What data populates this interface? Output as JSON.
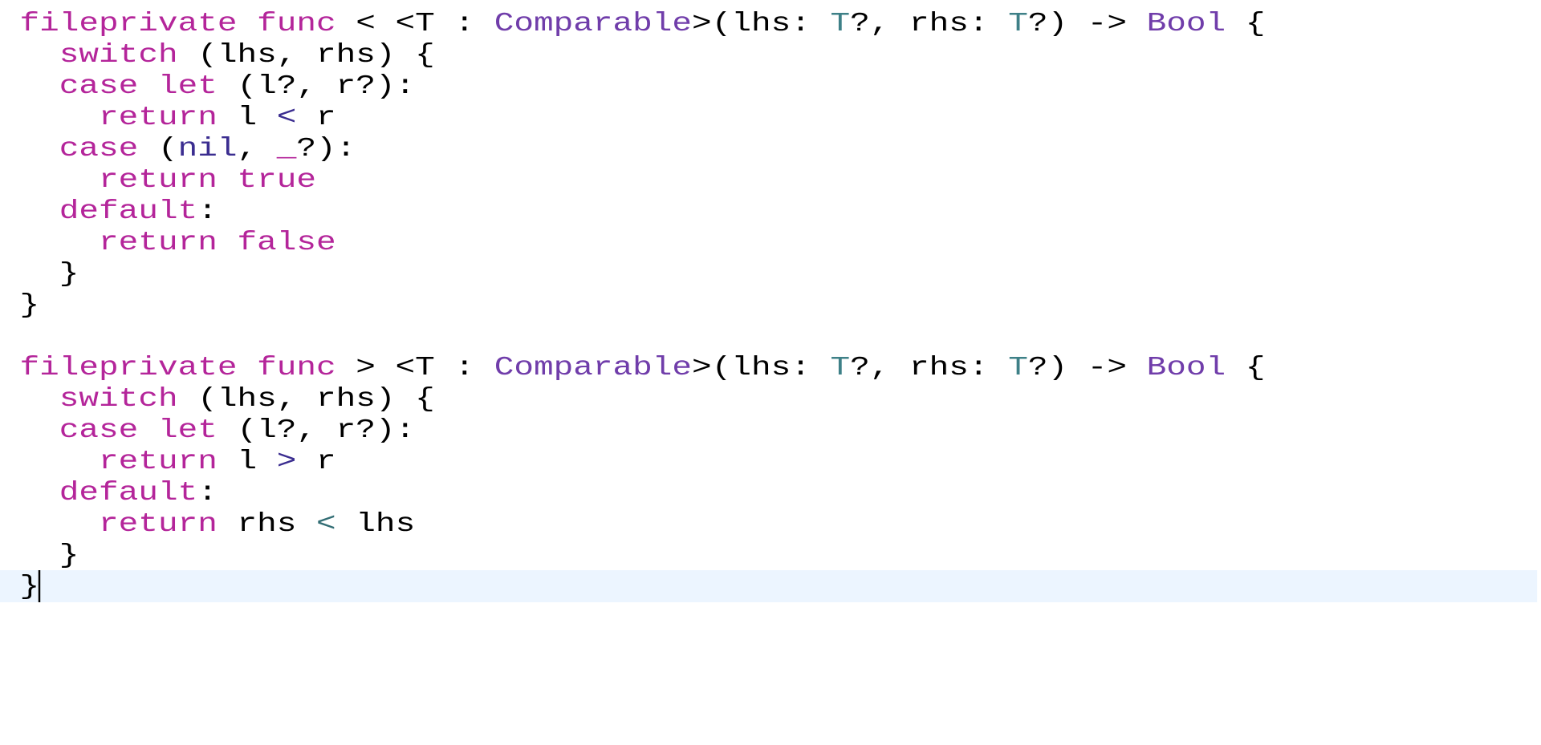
{
  "editor": {
    "colors": {
      "keyword": "#b4259a",
      "type": "#703daa",
      "type_param": "#3e8087",
      "literal": "#b4259a",
      "nil": "#3b2d90",
      "operator": "#3b2d90",
      "operator_alt": "#326d74",
      "plain": "#000000",
      "current_line_bg": "#ecf5ff"
    },
    "current_line": 19,
    "lines": [
      {
        "tokens": [
          {
            "t": "fileprivate",
            "c": "kw"
          },
          {
            "t": " "
          },
          {
            "t": "func",
            "c": "kw"
          },
          {
            "t": " < <T : "
          },
          {
            "t": "Comparable",
            "c": "type"
          },
          {
            "t": ">(lhs: "
          },
          {
            "t": "T",
            "c": "tp"
          },
          {
            "t": "?, rhs: "
          },
          {
            "t": "T",
            "c": "tp"
          },
          {
            "t": "?) -> "
          },
          {
            "t": "Bool",
            "c": "type"
          },
          {
            "t": " {"
          }
        ]
      },
      {
        "tokens": [
          {
            "t": "  "
          },
          {
            "t": "switch",
            "c": "kw"
          },
          {
            "t": " (lhs, rhs) {"
          }
        ]
      },
      {
        "tokens": [
          {
            "t": "  "
          },
          {
            "t": "case",
            "c": "kw"
          },
          {
            "t": " "
          },
          {
            "t": "let",
            "c": "kw"
          },
          {
            "t": " (l?, r?):"
          }
        ]
      },
      {
        "tokens": [
          {
            "t": "    "
          },
          {
            "t": "return",
            "c": "kw"
          },
          {
            "t": " l "
          },
          {
            "t": "<",
            "c": "op"
          },
          {
            "t": " r"
          }
        ]
      },
      {
        "tokens": [
          {
            "t": "  "
          },
          {
            "t": "case",
            "c": "kw"
          },
          {
            "t": " ("
          },
          {
            "t": "nil",
            "c": "nil"
          },
          {
            "t": ", "
          },
          {
            "t": "_",
            "c": "kw"
          },
          {
            "t": "?):"
          }
        ]
      },
      {
        "tokens": [
          {
            "t": "    "
          },
          {
            "t": "return",
            "c": "kw"
          },
          {
            "t": " "
          },
          {
            "t": "true",
            "c": "lit"
          }
        ]
      },
      {
        "tokens": [
          {
            "t": "  "
          },
          {
            "t": "default",
            "c": "kw"
          },
          {
            "t": ":"
          }
        ]
      },
      {
        "tokens": [
          {
            "t": "    "
          },
          {
            "t": "return",
            "c": "kw"
          },
          {
            "t": " "
          },
          {
            "t": "false",
            "c": "lit"
          }
        ]
      },
      {
        "tokens": [
          {
            "t": "  }"
          }
        ]
      },
      {
        "tokens": [
          {
            "t": "}"
          }
        ]
      },
      {
        "tokens": []
      },
      {
        "tokens": [
          {
            "t": "fileprivate",
            "c": "kw"
          },
          {
            "t": " "
          },
          {
            "t": "func",
            "c": "kw"
          },
          {
            "t": " > <T : "
          },
          {
            "t": "Comparable",
            "c": "type"
          },
          {
            "t": ">(lhs: "
          },
          {
            "t": "T",
            "c": "tp"
          },
          {
            "t": "?, rhs: "
          },
          {
            "t": "T",
            "c": "tp"
          },
          {
            "t": "?) -> "
          },
          {
            "t": "Bool",
            "c": "type"
          },
          {
            "t": " {"
          }
        ]
      },
      {
        "tokens": [
          {
            "t": "  "
          },
          {
            "t": "switch",
            "c": "kw"
          },
          {
            "t": " (lhs, rhs) {"
          }
        ]
      },
      {
        "tokens": [
          {
            "t": "  "
          },
          {
            "t": "case",
            "c": "kw"
          },
          {
            "t": " "
          },
          {
            "t": "let",
            "c": "kw"
          },
          {
            "t": " (l?, r?):"
          }
        ]
      },
      {
        "tokens": [
          {
            "t": "    "
          },
          {
            "t": "return",
            "c": "kw"
          },
          {
            "t": " l "
          },
          {
            "t": ">",
            "c": "op"
          },
          {
            "t": " r"
          }
        ]
      },
      {
        "tokens": [
          {
            "t": "  "
          },
          {
            "t": "default",
            "c": "kw"
          },
          {
            "t": ":"
          }
        ]
      },
      {
        "tokens": [
          {
            "t": "    "
          },
          {
            "t": "return",
            "c": "kw"
          },
          {
            "t": " rhs "
          },
          {
            "t": "<",
            "c": "op2"
          },
          {
            "t": " lhs"
          }
        ]
      },
      {
        "tokens": [
          {
            "t": "  }"
          }
        ]
      },
      {
        "tokens": [
          {
            "t": "}"
          }
        ]
      }
    ]
  }
}
